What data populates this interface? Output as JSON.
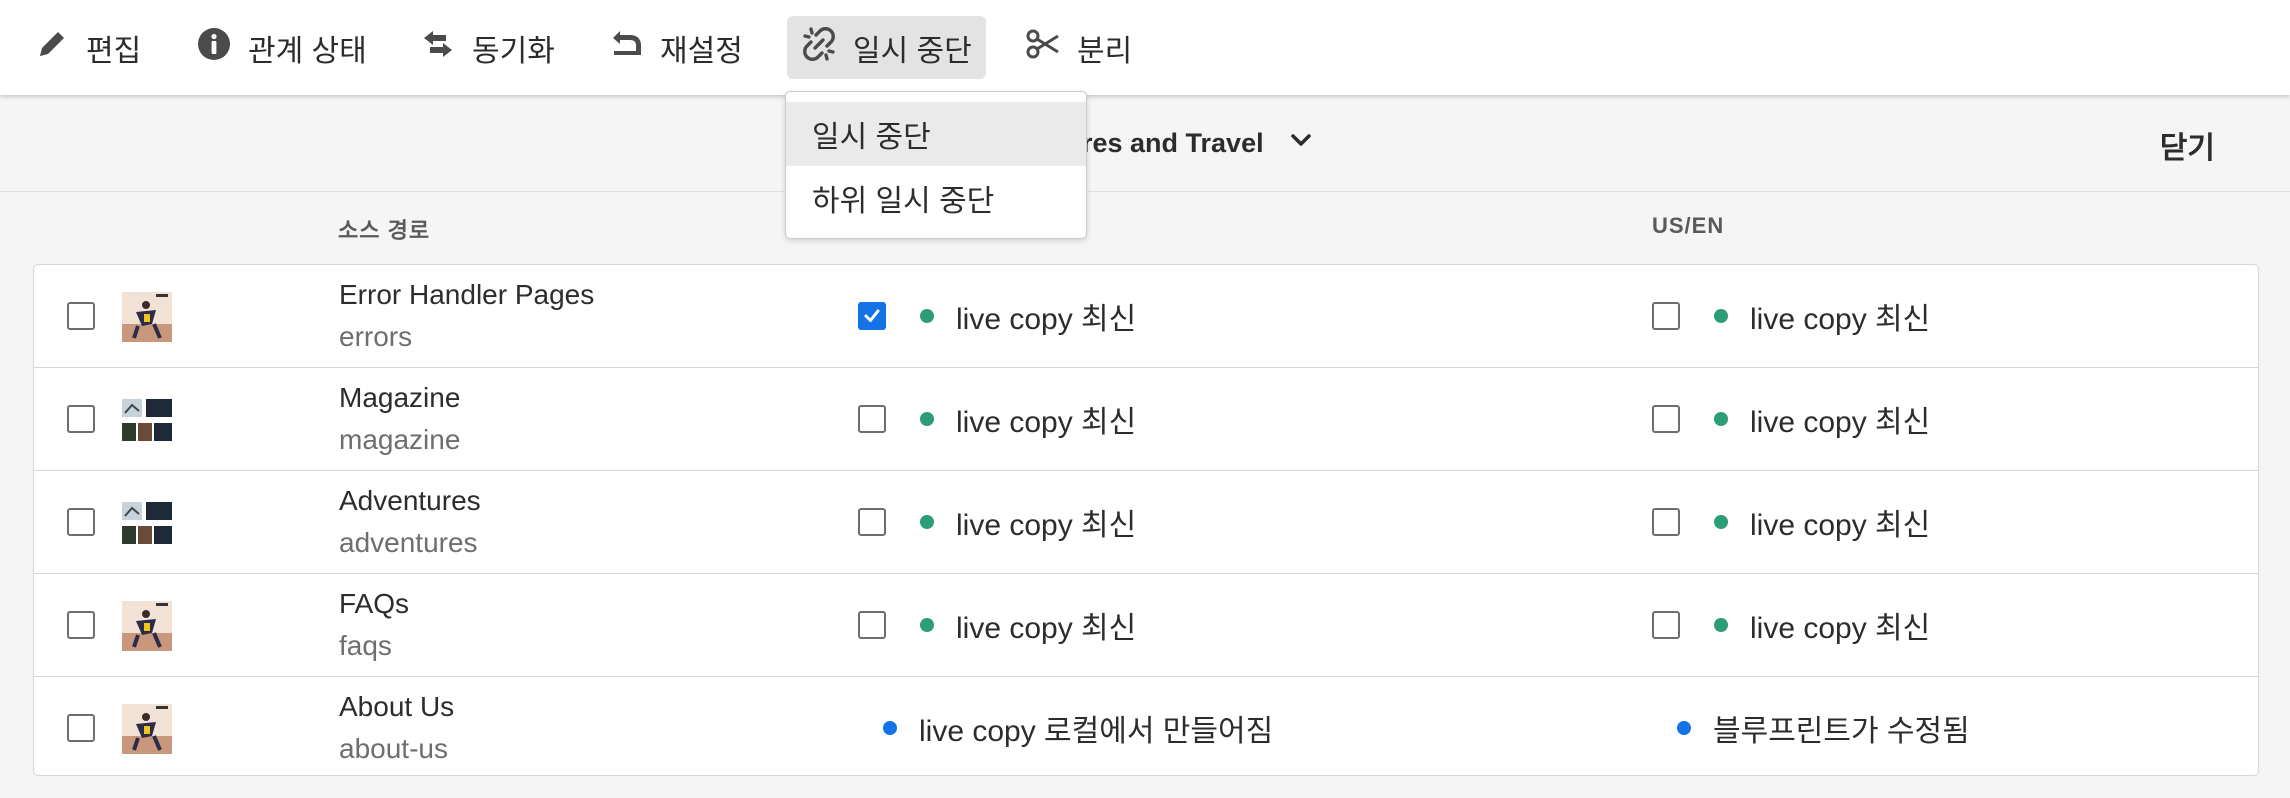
{
  "toolbar": {
    "edit": {
      "label": "편집",
      "icon": "pencil-icon"
    },
    "relationship_status": {
      "label": "관계 상태",
      "icon": "info-icon"
    },
    "synchronize": {
      "label": "동기화",
      "icon": "sync-arrows-icon"
    },
    "reset": {
      "label": "재설정",
      "icon": "undo-icon"
    },
    "suspend": {
      "label": "일시 중단",
      "icon": "broken-link-icon",
      "selected": true
    },
    "detach": {
      "label": "분리",
      "icon": "scissors-icon"
    }
  },
  "suspend_menu": {
    "items": [
      "일시 중단",
      "하위 일시 중단"
    ]
  },
  "titlebar": {
    "title": "ntures and Travel",
    "close_label": "닫기"
  },
  "columns": {
    "source_path": "소스 경로",
    "us_en": "US/EN"
  },
  "rows": [
    {
      "name": "Error Handler Pages",
      "path": "errors",
      "col1": {
        "checkbox": true,
        "checked": true,
        "status": "live copy 최신"
      },
      "col2": {
        "checkbox": true,
        "checked": false,
        "status": "live copy 최신"
      }
    },
    {
      "name": "Magazine",
      "path": "magazine",
      "col1": {
        "checkbox": true,
        "checked": false,
        "status": "live copy 최신"
      },
      "col2": {
        "checkbox": true,
        "checked": false,
        "status": "live copy 최신"
      }
    },
    {
      "name": "Adventures",
      "path": "adventures",
      "col1": {
        "checkbox": true,
        "checked": false,
        "status": "live copy 최신"
      },
      "col2": {
        "checkbox": true,
        "checked": false,
        "status": "live copy 최신"
      }
    },
    {
      "name": "FAQs",
      "path": "faqs",
      "col1": {
        "checkbox": true,
        "checked": false,
        "status": "live copy 최신"
      },
      "col2": {
        "checkbox": true,
        "checked": false,
        "status": "live copy 최신"
      }
    },
    {
      "name": "About Us",
      "path": "about-us",
      "col1": {
        "checkbox": false,
        "status": "live copy 로컬에서 만들어짐"
      },
      "col2": {
        "checkbox": false,
        "status": "블루프린트가 수정됨"
      }
    }
  ],
  "colors": {
    "status_green": "#2d9d78",
    "status_blue": "#1473e6",
    "checkbox_blue": "#1473e6",
    "toolbar_selected": "#e3e3e3"
  }
}
